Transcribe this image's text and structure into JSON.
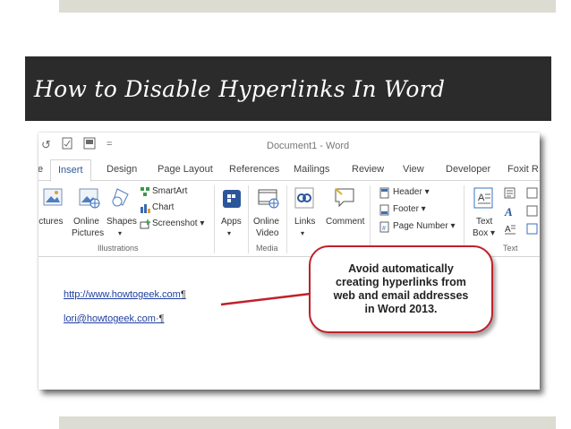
{
  "slide": {
    "title": "How to Disable Hyperlinks In Word"
  },
  "word": {
    "window_title": "Document1 - Word",
    "quick_access": {
      "undo_icon": "undo-icon",
      "redo_icon": "redo-icon",
      "customize_icon": "customize-icon",
      "more": "="
    },
    "tabs": [
      {
        "label": "e"
      },
      {
        "label": "Insert",
        "active": true
      },
      {
        "label": "Design"
      },
      {
        "label": "Page Layout"
      },
      {
        "label": "References"
      },
      {
        "label": "Mailings"
      },
      {
        "label": "Review"
      },
      {
        "label": "View"
      },
      {
        "label": "Developer"
      },
      {
        "label": "Foxit R"
      }
    ],
    "ribbon": {
      "pictures": "ictures",
      "online_pictures_1": "Online",
      "online_pictures_2": "Pictures",
      "shapes": "Shapes",
      "shapes_arrow": "▾",
      "smartart": "SmartArt",
      "chart": "Chart",
      "screenshot": "Screenshot ▾",
      "illustrations_group": "Illustrations",
      "apps": "Apps",
      "apps_arrow": "▾",
      "online_video_1": "Online",
      "online_video_2": "Video",
      "media_group": "Media",
      "links": "Links",
      "links_arrow": "▾",
      "comment": "Comment",
      "header": "Header ▾",
      "footer": "Footer ▾",
      "page_number": "Page Number ▾",
      "text_box_1": "Text",
      "text_box_2": "Box ▾",
      "text_group": "Text"
    },
    "document": {
      "link1": "http://www.howtogeek.com",
      "link2": "lori@howtogeek.com",
      "pilcrow1": "¶",
      "pilcrow2": "·¶"
    },
    "callout": "Avoid automatically\ncreating hyperlinks from\nweb and email addresses\nin Word 2013."
  },
  "colors": {
    "banner": "#2b2b2b",
    "band": "#dcdcd2",
    "callout_border": "#c0202a",
    "active_tab": "#2b579a"
  }
}
